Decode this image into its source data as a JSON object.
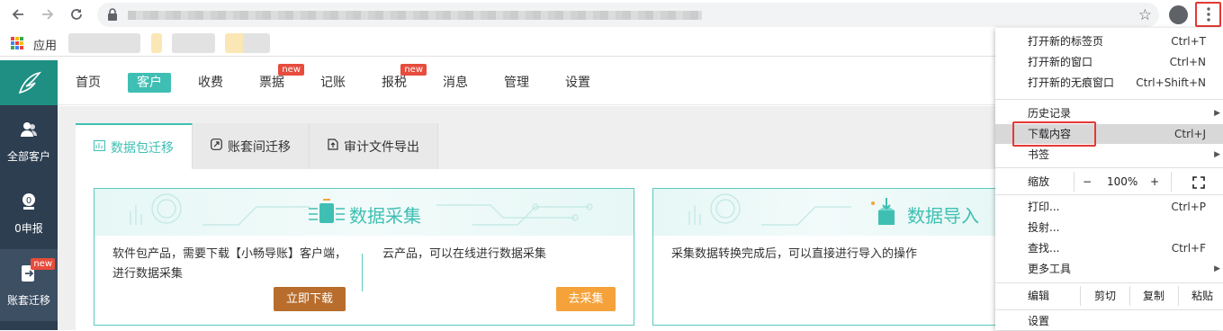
{
  "browser": {
    "apps_label": "应用",
    "menu": {
      "items": [
        {
          "label": "打开新的标签页",
          "shortcut": "Ctrl+T"
        },
        {
          "label": "打开新的窗口",
          "shortcut": "Ctrl+N"
        },
        {
          "label": "打开新的无痕窗口",
          "shortcut": "Ctrl+Shift+N"
        },
        {
          "label": "历史记录",
          "shortcut": ""
        },
        {
          "label": "下载内容",
          "shortcut": "Ctrl+J"
        },
        {
          "label": "书签",
          "shortcut": ""
        },
        {
          "label": "打印...",
          "shortcut": "Ctrl+P"
        },
        {
          "label": "投射...",
          "shortcut": ""
        },
        {
          "label": "查找...",
          "shortcut": "Ctrl+F"
        },
        {
          "label": "更多工具",
          "shortcut": ""
        },
        {
          "label": "设置",
          "shortcut": ""
        }
      ],
      "zoom": {
        "label": "缩放",
        "minus": "−",
        "value": "100%",
        "plus": "+"
      },
      "edit": {
        "label": "编辑",
        "cut": "剪切",
        "copy": "复制",
        "paste": "粘贴"
      }
    }
  },
  "sidebar": {
    "items": [
      {
        "label": "全部客户",
        "icon": "users-icon"
      },
      {
        "label": "0申报",
        "icon": "tax-zero-icon"
      },
      {
        "label": "账套迁移",
        "icon": "migrate-icon",
        "badge": "new"
      }
    ]
  },
  "topnav": {
    "items": [
      {
        "label": "首页"
      },
      {
        "label": "客户",
        "active": true
      },
      {
        "label": "收费"
      },
      {
        "label": "票据",
        "badge": "new"
      },
      {
        "label": "记账"
      },
      {
        "label": "报税",
        "badge": "new"
      },
      {
        "label": "消息"
      },
      {
        "label": "管理"
      },
      {
        "label": "设置"
      }
    ]
  },
  "tabs": [
    {
      "label": "数据包迁移",
      "active": true
    },
    {
      "label": "账套间迁移"
    },
    {
      "label": "审计文件导出"
    }
  ],
  "cards": {
    "collect": {
      "title": "数据采集",
      "left_text": "软件包产品，需要下载【小畅导账】客户端，进行数据采集",
      "left_button": "立即下载",
      "right_text": "云产品，可以在线进行数据采集",
      "right_button": "去采集"
    },
    "import": {
      "title": "数据导入",
      "text": "采集数据转换完成后，可以直接进行导入的操作"
    }
  },
  "colors": {
    "accent": "#3fbfb4",
    "download_btn": "#b86d2c",
    "collect_btn": "#f5a23a",
    "highlight_red": "#e53935"
  }
}
